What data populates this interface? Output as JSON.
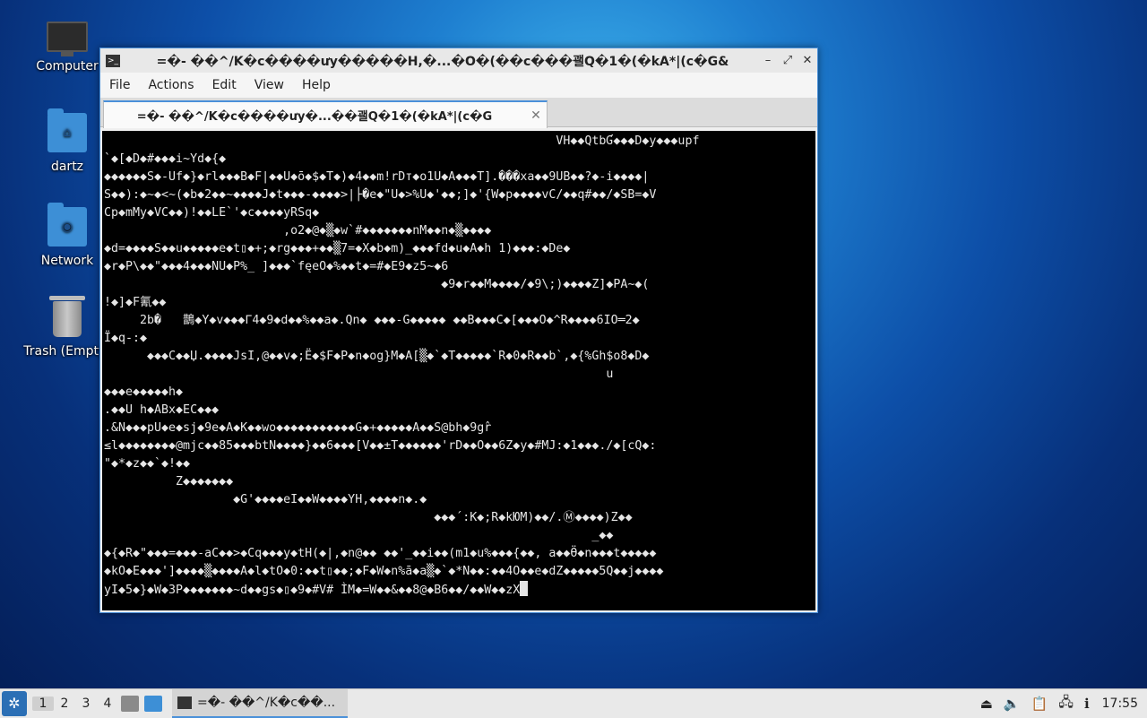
{
  "desktop": {
    "icons": [
      {
        "label": "Computer",
        "glyph": "monitor-icon"
      },
      {
        "label": "dartz",
        "glyph": "home-folder-icon"
      },
      {
        "label": "Network",
        "glyph": "network-folder-icon"
      },
      {
        "label": "Trash (Empty)",
        "glyph": "trash-icon"
      }
    ]
  },
  "window": {
    "title": "=�- ��^/K�c����ưy�����H,�...�O�(��c���괠Q�1�(�kA*|(c�G&",
    "controls": {
      "minimize": "–",
      "maximize": "⤢",
      "close": "✕"
    },
    "menu": [
      "File",
      "Actions",
      "Edit",
      "View",
      "Help"
    ],
    "tab": {
      "label": "=�- ��^/K�c����ưy�...��괠Q�1�(�kA*|(c�G",
      "close": "✕"
    }
  },
  "terminal": {
    "lines": [
      "                                                               VH◆◆QtbƓ◆◆◆D◆y◆◆◆upf",
      "`◆[◆D◆#◆◆◆i~Yd◆{◆",
      "◆◆◆◆◆◆S◆-Uf◆}◆rl◆◆◆B◆F|◆◆U◆ō◆$◆T◆)◆4◆◆m!rDт◆o1U◆A◆◆◆T].���xa◆◆9UB◆◆?◆-i◆◆◆◆|",
      "S◆◆):◆~◆<~(◆b◆2◆◆~◆◆◆◆J◆t◆◆◆-◆◆◆◆>|├�e◆\"U◆>%U◆'◆◆;]◆'{W◆p◆◆◆◆vC/◆◆q#◆◆/◆SB=◆V",
      "Cp◆mMy◆VC◆◆)!◆◆LE`'◆c◆◆◆◆yRSq◆",
      "                         ,o2◆@◆▒◆w`#◆◆◆◆◆◆◆nM◆◆n◆▒◆◆◆◆",
      "◆d=◆◆◆◆S◆◆u◆◆◆◆◆e◆t▯◆+;◆rg◆◆◆+◆◆▒7=◆X◆b◆m)_◆◆◆fd◆u◆A◆h 1)◆◆◆:◆De◆",
      "◆r◆P\\◆◆\"◆◆◆4◆◆◆NU◆P%_ ]◆◆◆`fęeO◆%◆◆t◆=#◆E9◆z5~◆6",
      "                                               ◆9◆r◆◆M◆◆◆◆/◆9\\;)◆◆◆◆Z]◆PA~◆(",
      "!◆]◆F氰◆◆",
      "     2b�   鵲◆Y◆v◆◆◆Γ4◆9◆d◆◆%◆◆a◆.Qn◆ ◆◆◆-G◆◆◆◆◆ ◆◆B◆◆◆C◆[◆◆◆O◆^R◆◆◆◆6IO═2◆",
      "Ï◆q-:◆",
      "      ◆◆◆C◆◆Џ.◆◆◆◆JsI,@◆◆v◆;Ë◆$F◆P◆n◆og}M◆A[▒◆`◆T◆◆◆◆◆`R◆0◆R◆◆b`,◆{%Gh$o8◆D◆",
      "                                                                      u",
      "◆◆◆e◆◆◆◆◆h◆",
      ".◆◆U h◆ABx◆EC◆◆◆",
      ".&N◆◆◆pU◆e◆sj◆9e◆A◆K◆◆wo◆◆◆◆◆◆◆◆◆◆◆G◆+◆◆◆◆◆A◆◆S@bh◆9gr̂",
      "≤l◆◆◆◆◆◆◆◆@mjc◆◆85◆◆◆btN◆◆◆◆}◆◆6◆◆◆[V◆◆±T◆◆◆◆◆◆'rD◆◆O◆◆6Z◆y◆#MJ:◆1◆◆◆./◆[cQ◆:",
      "\"◆*◆z◆◆`◆!◆◆",
      "          Z◆◆◆◆◆◆◆",
      "                  ◆G'◆◆◆◆eI◆◆W◆◆◆◆YH,◆◆◆◆n◆.◆",
      "                                              ◆◆◆´:K◆;R◆kЮM)◆◆/.Ⓜ◆◆◆◆)Z◆◆",
      "                                                                    _◆◆",
      "◆{◆R◆\"◆◆◆=◆◆◆-aC◆◆>◆Cq◆◆◆y◆tH(◆|,◆n@◆◆ ◆◆'_◆◆i◆◆(m1◆u%◆◆◆{◆◆, a◆◆Ӫ◆n◆◆◆t◆◆◆◆◆",
      "◆kO◆E◆◆◆']◆◆◆◆▒◆◆◆◆A◆l◆tO◆0:◆◆t▯◆◆;◆F◆W◆n%ā◆a▒◆`◆*N◆◆:◆◆4O◆◆e◆dZ◆◆◆◆◆5Q◆◆j◆◆◆◆",
      "yI◆5◆}◆W◆3P◆◆◆◆◆◆◆~d◆◆gs◆▯◆9◆#V# ÌM◆=W◆◆&◆◆8@◆B6◆◆/◆◆W◆◆zX"
    ]
  },
  "taskbar": {
    "workspaces": [
      "1",
      "2",
      "3",
      "4"
    ],
    "active_workspace": "1",
    "task_label": "=�- ��^/K�c��...",
    "clock": "17:55",
    "tray_icons": [
      "eject-icon",
      "volume-icon",
      "clipboard-icon",
      "network-icon",
      "update-icon"
    ]
  }
}
